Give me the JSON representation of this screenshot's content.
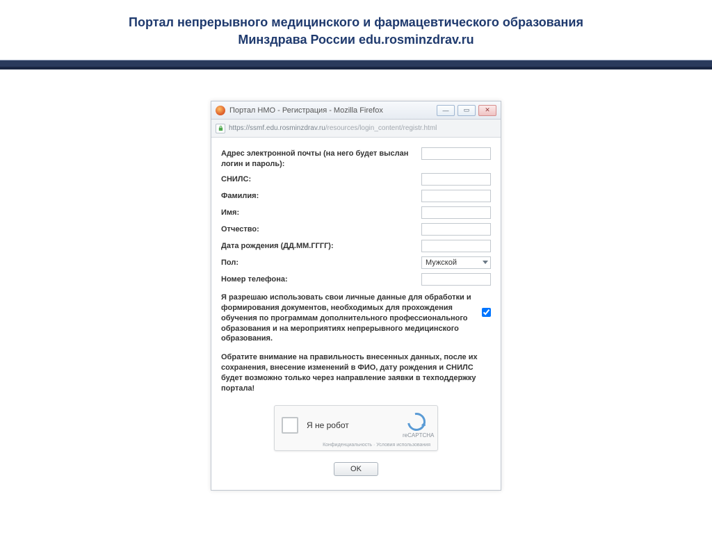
{
  "page": {
    "title_line1": "Портал непрерывного медицинского и фармацевтического образования",
    "title_line2": "Минздрава России edu.rosminzdrav.ru"
  },
  "browser": {
    "title": "Портал НМО - Регистрация - Mozilla Firefox",
    "url_host": "https://ssmf.edu.rosminzdrav.ru",
    "url_path": "/resources/login_content/registr.html",
    "win": {
      "min": "—",
      "max": "▭",
      "close": "✕"
    }
  },
  "form": {
    "email_label": "Адрес электронной почты (на него будет выслан логин и пароль):",
    "snils_label": "СНИЛС:",
    "lastname_label": "Фамилия:",
    "firstname_label": "Имя:",
    "patronymic_label": "Отчество:",
    "dob_label": "Дата рождения (ДД.ММ.ГГГГ):",
    "gender_label": "Пол:",
    "gender_value": "Мужской",
    "phone_label": "Номер телефона:",
    "email_value": "",
    "snils_value": "",
    "lastname_value": "",
    "firstname_value": "",
    "patronymic_value": "",
    "dob_value": "",
    "phone_value": ""
  },
  "consent": {
    "text": "Я разрешаю использовать свои личные данные для обработки и формирования документов, необходимых для прохождения обучения по программам дополнительного профессионального образования и на мероприятиях непрерывного медицинского образования.",
    "checked": true
  },
  "note": "Обратите внимание на правильность внесенных данных, после их сохранения, внесение изменений в ФИО, дату рождения и СНИЛС будет возможно только через направление заявки в техподдержку портала!",
  "captcha": {
    "label": "Я не робот",
    "brand": "reCAPTCHA",
    "links": "Конфиденциальность · Условия использования"
  },
  "buttons": {
    "ok": "OK"
  }
}
